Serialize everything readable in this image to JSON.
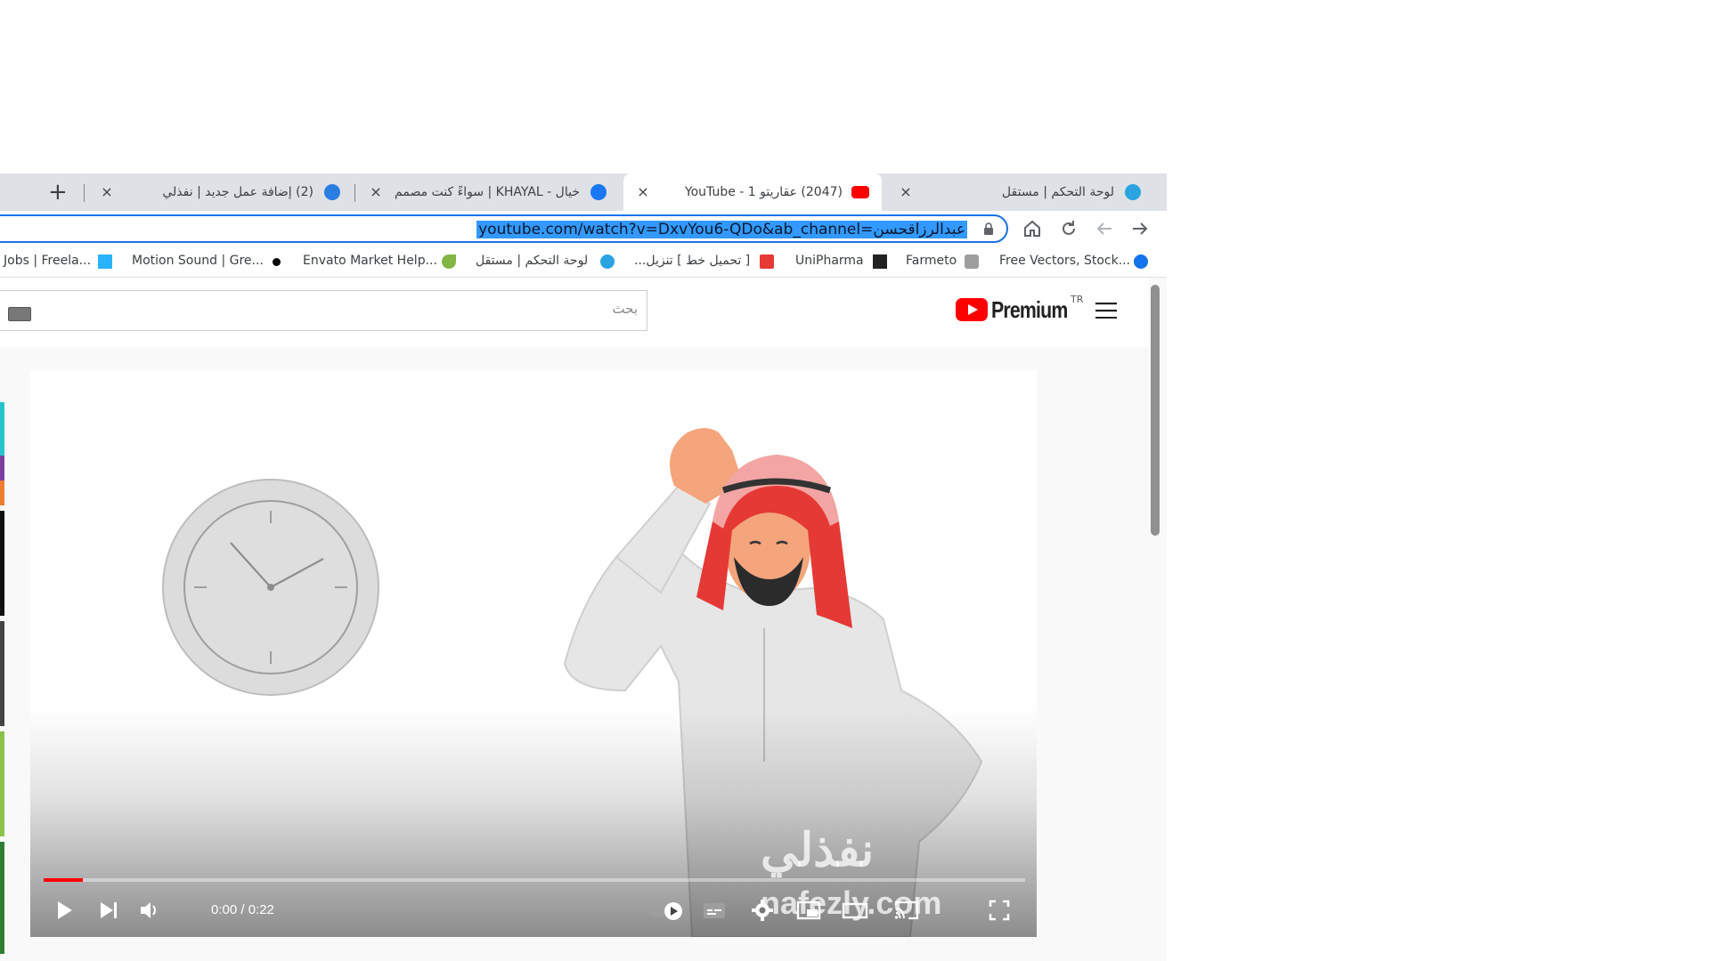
{
  "tabs": [
    {
      "title": "لوحة التحكم | مستقل",
      "favicon": "mostaql-icon",
      "color": "#2aa3e0"
    },
    {
      "title": "(2047) عقاريتو 1 - YouTube",
      "favicon": "youtube-icon",
      "color": "#ff0000"
    },
    {
      "title": "خيال - KHAYAL | سواءً كنت مصمم",
      "favicon": "facebook-icon",
      "color": "#1877f2"
    },
    {
      "title": "(2) إضافة عمل جديد | نفذلي",
      "favicon": "nafezly-icon",
      "color": "#2a7de1"
    }
  ],
  "new_tab_label": "+",
  "close_label": "×",
  "address_bar": {
    "url": "youtube.com/watch?v=DxvYou6-QDo&ab_channel=عبدالرزاقحسن"
  },
  "toolbar": {
    "forward_icon": "arrow-right-icon",
    "back_icon": "arrow-left-icon",
    "reload_icon": "reload-icon",
    "home_icon": "home-icon"
  },
  "bookmarks": [
    {
      "label": "Free Vectors, Stock...",
      "icon": "freepik-icon",
      "color": "#1273eb"
    },
    {
      "label": "Farmeto",
      "icon": "farmeto-icon",
      "color": "#9e9e9e"
    },
    {
      "label": "UniPharma",
      "icon": "unipharma-icon",
      "color": "#222222"
    },
    {
      "label": "[ تحميل خط ] تنزيل...",
      "icon": "font-icon",
      "color": "#e53935"
    },
    {
      "label": "لوحة التحكم | مستقل",
      "icon": "mostaql-icon",
      "color": "#2aa3e0"
    },
    {
      "label": "Envato Market Help...",
      "icon": "envato-icon",
      "color": "#82b541"
    },
    {
      "label": "Motion Sound | Gre...",
      "icon": "dot-icon",
      "color": "#000000"
    },
    {
      "label": "Jobs | Freela...",
      "icon": "freelancer-icon",
      "color": "#29b2fe"
    }
  ],
  "youtube": {
    "search_placeholder": "بحث",
    "logo_text": "Premium",
    "region": "TR",
    "brand_color": "#ff0000"
  },
  "player": {
    "time": "0:00 / 0:22",
    "progress": 0.04,
    "watermark_ar": "نفذلي",
    "watermark_en": "nafezly.com"
  }
}
